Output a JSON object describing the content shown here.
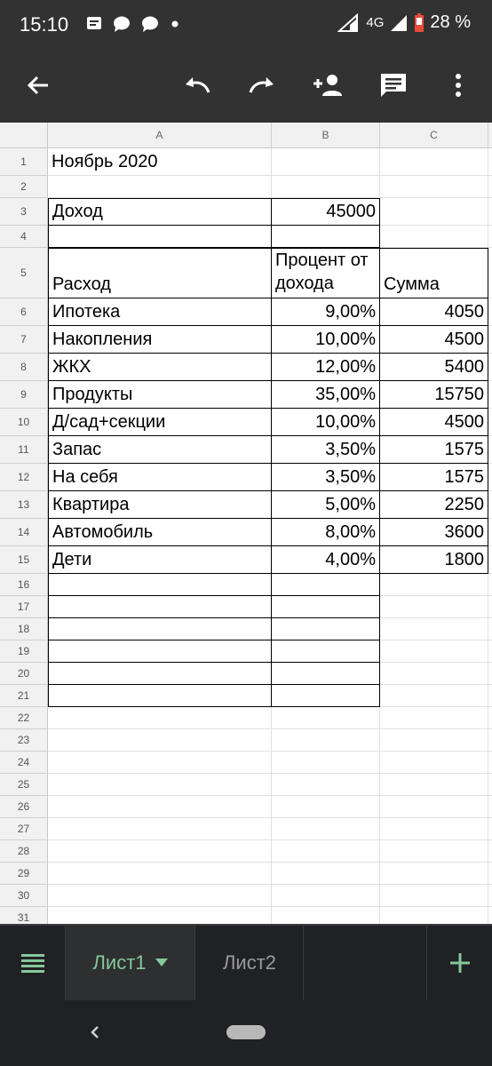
{
  "status": {
    "time": "15:10",
    "network": "4G",
    "battery": "28 %",
    "notification_icons": [
      "message-icon",
      "chat-icon",
      "chat-icon",
      "dot-icon"
    ]
  },
  "toolbar": {
    "icons": [
      "back-arrow-icon",
      "undo-icon",
      "redo-icon",
      "add-person-icon",
      "comment-icon",
      "more-vert-icon"
    ]
  },
  "sheet": {
    "columns": [
      "A",
      "B",
      "C"
    ],
    "row_numbers": [
      "1",
      "2",
      "3",
      "4",
      "5",
      "6",
      "7",
      "8",
      "9",
      "10",
      "11",
      "12",
      "13",
      "14",
      "15",
      "16",
      "17",
      "18",
      "19",
      "20",
      "21",
      "22",
      "23",
      "24",
      "25",
      "26",
      "27",
      "28",
      "29",
      "30",
      "31"
    ],
    "title": "Ноябрь 2020",
    "income_label": "Доход",
    "income_value": "45000",
    "header_expense": "Расход",
    "header_percent": "Процент от дохода",
    "header_sum": "Сумма",
    "rows": [
      {
        "name": "Ипотека",
        "percent": "9,00%",
        "sum": "4050"
      },
      {
        "name": "Накопления",
        "percent": "10,00%",
        "sum": "4500"
      },
      {
        "name": "ЖКХ",
        "percent": "12,00%",
        "sum": "5400"
      },
      {
        "name": "Продукты",
        "percent": "35,00%",
        "sum": "15750"
      },
      {
        "name": "Д/сад+секции",
        "percent": "10,00%",
        "sum": "4500"
      },
      {
        "name": "Запас",
        "percent": "3,50%",
        "sum": "1575"
      },
      {
        "name": "На себя",
        "percent": "3,50%",
        "sum": "1575"
      },
      {
        "name": "Квартира",
        "percent": "5,00%",
        "sum": "2250"
      },
      {
        "name": "Автомобиль",
        "percent": "8,00%",
        "sum": "3600"
      },
      {
        "name": "Дети",
        "percent": "4,00%",
        "sum": "1800"
      }
    ]
  },
  "tabs": {
    "sheet1": "Лист1",
    "sheet2": "Лист2",
    "active_color": "#86c79a"
  }
}
